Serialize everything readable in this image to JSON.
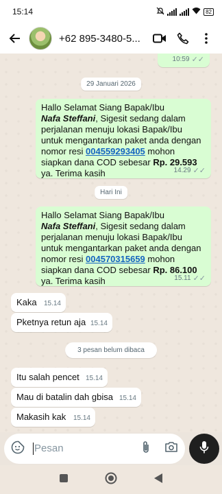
{
  "status": {
    "time": "15:14",
    "battery": "82"
  },
  "header": {
    "contact": "+62 895-3480-5..."
  },
  "messages": {
    "m0": {
      "time": "10:59"
    },
    "date1": "29 Januari 2026",
    "m1": {
      "line1": "Hallo Selamat Siang Bapak/Ibu",
      "name": "Nafa Steffani",
      "line2a": ", Sigesit sedang dalam perjalanan menuju lokasi Bapak/Ibu untuk mengantarkan paket anda dengan nomor resi ",
      "resi": "004559293405",
      "line2b": " mohon siapkan dana COD sebesar ",
      "amount": "Rp. 29.593",
      "line2c": " ya. Terima kasih",
      "time": "14.29"
    },
    "date2": "Hari Ini",
    "m2": {
      "line1": "Hallo Selamat Siang Bapak/Ibu",
      "name": "Nafa Steffani",
      "line2a": ", Sigesit sedang dalam perjalanan menuju lokasi Bapak/Ibu untuk mengantarkan paket anda dengan nomor resi ",
      "resi": "004570315659",
      "line2b": " mohon siapkan dana COD sebesar ",
      "amount": "Rp. 86.100",
      "line2c": " ya. Terima kasih",
      "time": "15.11"
    },
    "in1": {
      "text": "Kaka",
      "time": "15.14"
    },
    "in2": {
      "text": "Pketnya retun aja",
      "time": "15.14"
    },
    "unread": "3 pesan belum dibaca",
    "in3": {
      "text": "Itu salah pencet",
      "time": "15.14"
    },
    "in4": {
      "text": "Mau di batalin dah gbisa",
      "time": "15.14"
    },
    "in5": {
      "text": "Makasih kak",
      "time": "15.14"
    }
  },
  "input": {
    "placeholder": "Pesan"
  },
  "colors": {
    "outgoing": "#d9fdd3",
    "incoming": "#ffffff",
    "link": "#1565c0"
  }
}
